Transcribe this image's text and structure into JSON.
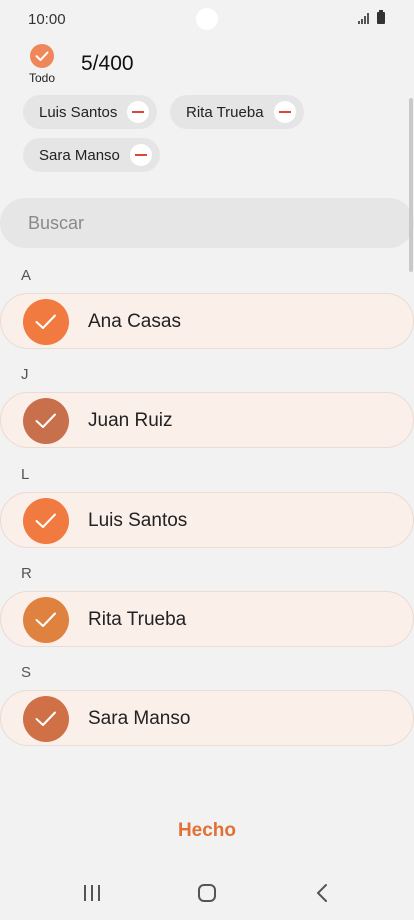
{
  "status": {
    "time": "10:00"
  },
  "header": {
    "select_all_label": "Todo",
    "count": "5/400"
  },
  "chips": [
    {
      "name": "Luis Santos"
    },
    {
      "name": "Rita Trueba"
    },
    {
      "name": "Sara Manso"
    }
  ],
  "search": {
    "placeholder": "Buscar"
  },
  "sections": [
    {
      "letter": "A",
      "contact": "Ana Casas",
      "avatar_color": "#f07a40"
    },
    {
      "letter": "J",
      "contact": "Juan Ruiz",
      "avatar_color": "#c8704c"
    },
    {
      "letter": "L",
      "contact": "Luis Santos",
      "avatar_color": "#f07a40"
    },
    {
      "letter": "R",
      "contact": "Rita Trueba",
      "avatar_color": "#e0823f"
    },
    {
      "letter": "S",
      "contact": "Sara Manso",
      "avatar_color": "#cf7047"
    }
  ],
  "footer": {
    "done_label": "Hecho"
  },
  "colors": {
    "accent": "#e07238",
    "check": "#f0875a",
    "row_bg": "#fbefea",
    "remove": "#e0453a"
  },
  "icons": {
    "back": "chevron-left-icon",
    "home": "home-icon",
    "recents": "recents-icon"
  }
}
